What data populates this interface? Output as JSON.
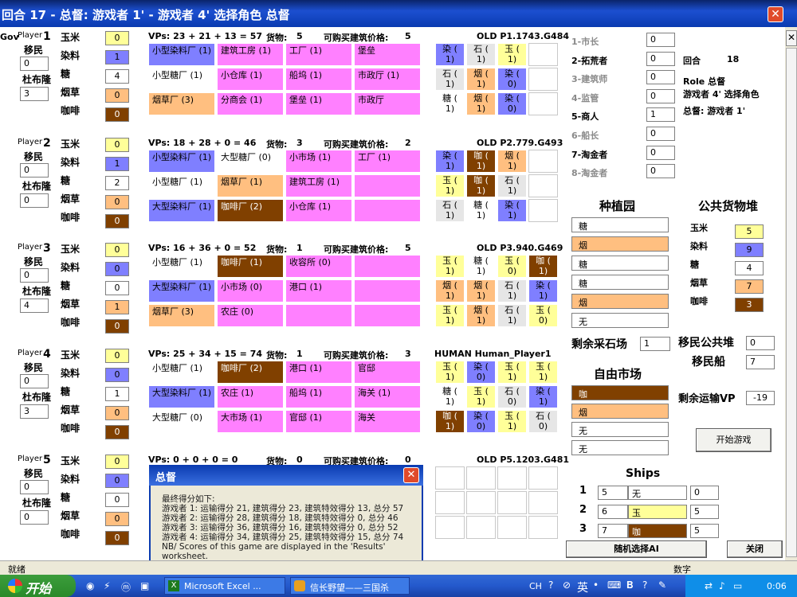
{
  "window": {
    "title": "回合 17 - 总督: 游戏者 1' - 游戏者 4' 选择角色 总督",
    "close": "✕"
  },
  "labels": {
    "player": "Player",
    "colonists": "移民",
    "doubloons": "杜布隆",
    "corn": "玉米",
    "indigo": "染料",
    "sugar": "糖",
    "tobacco": "烟草",
    "coffee": "咖啡"
  },
  "gov_stub": "Gov",
  "colors": {
    "corn": "#ffff99",
    "indigo": "#7f7fff",
    "sugar": "#ffffff",
    "tobacco": "#ffbf80",
    "coffee": "#804000",
    "violet": "#ff80ff",
    "grey": "#e6e6e6"
  },
  "players": [
    {
      "num": "1",
      "colonists": "0",
      "doubloons": "3",
      "goods": [
        "0",
        "1",
        "4",
        "0",
        "0"
      ],
      "vp_line": "VPs: 23 + 21 + 13 = 57",
      "cargo_label": "货物:",
      "cargo": "5",
      "buy_label": "可购买建筑价格:",
      "buy": "5",
      "ai": "OLD P1.1743.G484",
      "buildings": [
        [
          {
            "t": "小型染料厂 (1)",
            "c": "indigo"
          },
          {
            "t": "建筑工房 (1)",
            "c": "violet"
          },
          {
            "t": "工厂 (1)",
            "c": "violet"
          },
          {
            "t": "堡垒",
            "c": "violet"
          }
        ],
        [
          {
            "t": "小型糖厂 (1)",
            "c": "sugar"
          },
          {
            "t": "小仓库 (1)",
            "c": "violet"
          },
          {
            "t": "船坞 (1)",
            "c": "violet"
          },
          {
            "t": "市政厅 (1)",
            "c": "violet"
          }
        ],
        [
          {
            "t": "烟草厂 (3)",
            "c": "tobacco"
          },
          {
            "t": "分商会 (1)",
            "c": "violet"
          },
          {
            "t": "堡垒 (1)",
            "c": "violet"
          },
          {
            "t": "市政厅",
            "c": "violet"
          }
        ]
      ],
      "plantations": [
        [
          {
            "t": "染 (\n1)",
            "c": "indigo"
          },
          {
            "t": "石 (\n1)",
            "c": "grey"
          },
          {
            "t": "玉 (\n1)",
            "c": "corn"
          },
          {
            "t": "",
            "c": "blank"
          }
        ],
        [
          {
            "t": "石 (\n1)",
            "c": "grey"
          },
          {
            "t": "烟 (\n1)",
            "c": "tobacco"
          },
          {
            "t": "染 (\n0)",
            "c": "indigo"
          },
          {
            "t": "",
            "c": "blank"
          }
        ],
        [
          {
            "t": "糖 (\n1)",
            "c": "sugar"
          },
          {
            "t": "烟 (\n1)",
            "c": "tobacco"
          },
          {
            "t": "染 (\n0)",
            "c": "indigo"
          },
          {
            "t": "",
            "c": "blank"
          }
        ]
      ]
    },
    {
      "num": "2",
      "colonists": "0",
      "doubloons": "0",
      "goods": [
        "0",
        "1",
        "2",
        "0",
        "0"
      ],
      "vp_line": "VPs: 18 + 28 + 0 = 46",
      "cargo_label": "货物:",
      "cargo": "3",
      "buy_label": "可购买建筑价格:",
      "buy": "2",
      "ai": "OLD P2.779.G493",
      "buildings": [
        [
          {
            "t": "小型染料厂 (1)",
            "c": "indigo"
          },
          {
            "t": "大型糖厂 (0)",
            "c": "sugar"
          },
          {
            "t": "小市场 (1)",
            "c": "violet"
          },
          {
            "t": "工厂 (1)",
            "c": "violet"
          }
        ],
        [
          {
            "t": "小型糖厂 (1)",
            "c": "sugar"
          },
          {
            "t": "烟草厂 (1)",
            "c": "tobacco"
          },
          {
            "t": "建筑工房 (1)",
            "c": "violet"
          },
          {
            "t": "",
            "c": "violet"
          }
        ],
        [
          {
            "t": "大型染料厂 (1)",
            "c": "indigo"
          },
          {
            "t": "咖啡厂 (2)",
            "c": "coffee"
          },
          {
            "t": "小仓库 (1)",
            "c": "violet"
          },
          {
            "t": "",
            "c": "violet"
          }
        ]
      ],
      "plantations": [
        [
          {
            "t": "染 (\n1)",
            "c": "indigo"
          },
          {
            "t": "咖 (\n1)",
            "c": "coffee"
          },
          {
            "t": "烟 (\n1)",
            "c": "tobacco"
          },
          {
            "t": "",
            "c": "blank"
          }
        ],
        [
          {
            "t": "玉 (\n1)",
            "c": "corn"
          },
          {
            "t": "咖 (\n1)",
            "c": "coffee"
          },
          {
            "t": "石 (\n1)",
            "c": "grey"
          },
          {
            "t": "",
            "c": "blank"
          }
        ],
        [
          {
            "t": "石 (\n1)",
            "c": "grey"
          },
          {
            "t": "糖 (\n1)",
            "c": "sugar"
          },
          {
            "t": "染 (\n1)",
            "c": "indigo"
          },
          {
            "t": "",
            "c": "blank"
          }
        ]
      ]
    },
    {
      "num": "3",
      "colonists": "0",
      "doubloons": "4",
      "goods": [
        "0",
        "0",
        "0",
        "1",
        "0"
      ],
      "vp_line": "VPs: 16 + 36 + 0 = 52",
      "cargo_label": "货物:",
      "cargo": "1",
      "buy_label": "可购买建筑价格:",
      "buy": "5",
      "ai": "OLD P3.940.G469",
      "buildings": [
        [
          {
            "t": "小型糖厂 (1)",
            "c": "sugar"
          },
          {
            "t": "咖啡厂 (1)",
            "c": "coffee"
          },
          {
            "t": "收容所 (0)",
            "c": "violet"
          },
          {
            "t": "",
            "c": "violet"
          }
        ],
        [
          {
            "t": "大型染料厂 (1)",
            "c": "indigo"
          },
          {
            "t": "小市场 (0)",
            "c": "violet"
          },
          {
            "t": "港口 (1)",
            "c": "violet"
          },
          {
            "t": "",
            "c": "violet"
          }
        ],
        [
          {
            "t": "烟草厂 (3)",
            "c": "tobacco"
          },
          {
            "t": "农庄 (0)",
            "c": "violet"
          },
          {
            "t": "",
            "c": "violet"
          },
          {
            "t": "",
            "c": "violet"
          }
        ]
      ],
      "plantations": [
        [
          {
            "t": "玉 (\n1)",
            "c": "corn"
          },
          {
            "t": "糖 (\n1)",
            "c": "sugar"
          },
          {
            "t": "玉 (\n0)",
            "c": "corn"
          },
          {
            "t": "咖 (\n1)",
            "c": "coffee"
          }
        ],
        [
          {
            "t": "烟 (\n1)",
            "c": "tobacco"
          },
          {
            "t": "烟 (\n1)",
            "c": "tobacco"
          },
          {
            "t": "石 (\n1)",
            "c": "grey"
          },
          {
            "t": "染 (\n1)",
            "c": "indigo"
          }
        ],
        [
          {
            "t": "玉 (\n1)",
            "c": "corn"
          },
          {
            "t": "烟 (\n1)",
            "c": "tobacco"
          },
          {
            "t": "石 (\n1)",
            "c": "grey"
          },
          {
            "t": "玉 (\n0)",
            "c": "corn"
          }
        ]
      ]
    },
    {
      "num": "4",
      "colonists": "0",
      "doubloons": "3",
      "goods": [
        "0",
        "0",
        "1",
        "0",
        "0"
      ],
      "vp_line": "VPs: 25 + 34 + 15 = 74",
      "cargo_label": "货物:",
      "cargo": "1",
      "buy_label": "可购买建筑价格:",
      "buy": "3",
      "ai": "HUMAN    Human_Player1",
      "buildings": [
        [
          {
            "t": "小型糖厂 (1)",
            "c": "sugar"
          },
          {
            "t": "咖啡厂 (2)",
            "c": "coffee"
          },
          {
            "t": "港口 (1)",
            "c": "violet"
          },
          {
            "t": "官邸",
            "c": "violet"
          }
        ],
        [
          {
            "t": "大型染料厂 (1)",
            "c": "indigo"
          },
          {
            "t": "农庄 (1)",
            "c": "violet"
          },
          {
            "t": "船坞 (1)",
            "c": "violet"
          },
          {
            "t": "海关 (1)",
            "c": "violet"
          }
        ],
        [
          {
            "t": "大型糖厂 (0)",
            "c": "sugar"
          },
          {
            "t": "大市场 (1)",
            "c": "violet"
          },
          {
            "t": "官邸 (1)",
            "c": "violet"
          },
          {
            "t": "海关",
            "c": "violet"
          }
        ]
      ],
      "plantations": [
        [
          {
            "t": "玉 (\n1)",
            "c": "corn"
          },
          {
            "t": "染 (\n0)",
            "c": "indigo"
          },
          {
            "t": "玉 (\n1)",
            "c": "corn"
          },
          {
            "t": "玉 (\n1)",
            "c": "corn"
          }
        ],
        [
          {
            "t": "糖 (\n1)",
            "c": "sugar"
          },
          {
            "t": "玉 (\n1)",
            "c": "corn"
          },
          {
            "t": "石 (\n0)",
            "c": "grey"
          },
          {
            "t": "染 (\n1)",
            "c": "indigo"
          }
        ],
        [
          {
            "t": "咖 (\n1)",
            "c": "coffee"
          },
          {
            "t": "染 (\n0)",
            "c": "indigo"
          },
          {
            "t": "玉 (\n1)",
            "c": "corn"
          },
          {
            "t": "石 (\n0)",
            "c": "grey"
          }
        ]
      ]
    },
    {
      "num": "5",
      "colonists": "0",
      "doubloons": "0",
      "goods": [
        "0",
        "0",
        "0",
        "0",
        "0"
      ],
      "vp_line": "VPs: 0 + 0 + 0 = 0",
      "cargo_label": "货物:",
      "cargo": "0",
      "buy_label": "可购买建筑价格:",
      "buy": "0",
      "ai": "OLD P5.1203.G481"
    }
  ],
  "roles": [
    {
      "name": "1-市长",
      "value": "0",
      "active": false
    },
    {
      "name": "2-拓荒者",
      "value": "0",
      "active": true
    },
    {
      "name": "3-建筑师",
      "value": "0",
      "active": false
    },
    {
      "name": "4-监管",
      "value": "0",
      "active": false
    },
    {
      "name": "5-商人",
      "value": "1",
      "active": true
    },
    {
      "name": "6-船长",
      "value": "0",
      "active": false
    },
    {
      "name": "7-淘金者",
      "value": "0",
      "active": true
    },
    {
      "name": "8-淘金者",
      "value": "0",
      "active": false
    }
  ],
  "status_panel": {
    "round_label": "回合",
    "round": "18",
    "role_line": "Role  总督",
    "choose_line": "游戏者 4' 选择角色",
    "governor_line": "总督: 游戏者 1'"
  },
  "plantation_title": "种植园",
  "plantation_rows": [
    {
      "t": "糖",
      "c": "sugar"
    },
    {
      "t": "烟",
      "c": "tobacco"
    },
    {
      "t": "糖",
      "c": "sugar"
    },
    {
      "t": "糖",
      "c": "sugar"
    },
    {
      "t": "烟",
      "c": "tobacco"
    },
    {
      "t": "无",
      "c": "sugar"
    }
  ],
  "supply_title": "公共货物堆",
  "supply": [
    {
      "label": "玉米",
      "value": "5",
      "c": "corn"
    },
    {
      "label": "染料",
      "value": "9",
      "c": "indigo"
    },
    {
      "label": "糖",
      "value": "4",
      "c": "sugar"
    },
    {
      "label": "烟草",
      "value": "7",
      "c": "tobacco"
    },
    {
      "label": "咖啡",
      "value": "3",
      "c": "coffee"
    }
  ],
  "quarry_label": "剩余采石场",
  "quarry_value": "1",
  "colonist_supply_label": "移民公共堆",
  "colonist_supply": "0",
  "colonist_ship_label": "移民船",
  "colonist_ship": "7",
  "market_title": "自由市场",
  "market_rows": [
    {
      "t": "咖",
      "c": "coffee"
    },
    {
      "t": "烟",
      "c": "tobacco"
    },
    {
      "t": "无",
      "c": "sugar"
    },
    {
      "t": "无",
      "c": "sugar"
    }
  ],
  "shipping_vp_label": "剩余运输VP",
  "shipping_vp": "-19",
  "start_button": "开始游戏",
  "ships_title": "Ships",
  "ships": [
    {
      "num": "1",
      "cap": "5",
      "cargo": "无",
      "c": "sugar",
      "count": "0"
    },
    {
      "num": "2",
      "cap": "6",
      "cargo": "玉",
      "c": "corn",
      "count": "5"
    },
    {
      "num": "3",
      "cap": "7",
      "cargo": "咖",
      "c": "coffee",
      "count": "5"
    }
  ],
  "random_role_button": "随机选择AI",
  "close_button": "关闭",
  "dialog": {
    "title": "总督",
    "lines": [
      "最终得分如下:",
      "游戏者 1: 运输得分 21, 建筑得分 23, 建筑特效得分 13, 总分 57",
      "游戏者 2: 运输得分 28, 建筑得分 18, 建筑特效得分 0, 总分 46",
      "游戏者 3: 运输得分 36, 建筑得分 16, 建筑特效得分 0, 总分 52",
      "游戏者 4: 运输得分 34, 建筑得分 25, 建筑特效得分 15, 总分 74",
      "NB/ Scores of this game are displayed in the 'Results' worksheet."
    ]
  },
  "statusbar": {
    "ready": "就绪",
    "mode": "数字"
  },
  "taskbar": {
    "start": "开始",
    "tasks": [
      "Microsoft Excel ...",
      "信长野望——三国杀"
    ],
    "lang": "CH",
    "ime": "英",
    "clock": "0:06"
  }
}
